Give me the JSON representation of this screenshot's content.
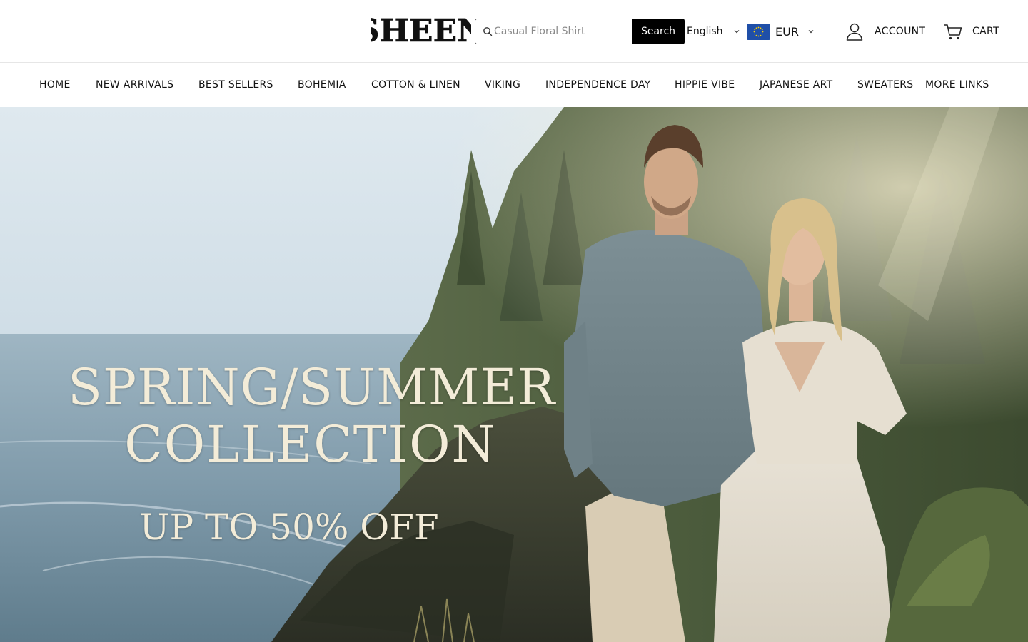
{
  "brand": {
    "name": "SHEEN"
  },
  "search": {
    "placeholder": "Casual Floral Shirt",
    "button_label": "Search"
  },
  "language": {
    "selected": "English"
  },
  "currency": {
    "selected": "EUR",
    "flag": "eu-flag-icon"
  },
  "account": {
    "label": "ACCOUNT",
    "icon": "account-icon"
  },
  "cart": {
    "label": "CART",
    "icon": "cart-icon"
  },
  "nav": {
    "items": [
      {
        "label": "HOME"
      },
      {
        "label": "NEW ARRIVALS"
      },
      {
        "label": "BEST SELLERS"
      },
      {
        "label": "BOHEMIA"
      },
      {
        "label": "COTTON & LINEN"
      },
      {
        "label": "VIKING"
      },
      {
        "label": "INDEPENDENCE DAY"
      },
      {
        "label": "HIPPIE VIBE"
      },
      {
        "label": "JAPANESE ART"
      },
      {
        "label": "SWEATERS"
      },
      {
        "label": "MORE LINKS"
      }
    ]
  },
  "hero": {
    "line1": "SPRING/SUMMER",
    "line2": "COLLECTION",
    "line3": "UP TO 50% OFF"
  },
  "colors": {
    "primary": "#000000",
    "text": "#121212",
    "hero_text": "#f3ecd8"
  }
}
